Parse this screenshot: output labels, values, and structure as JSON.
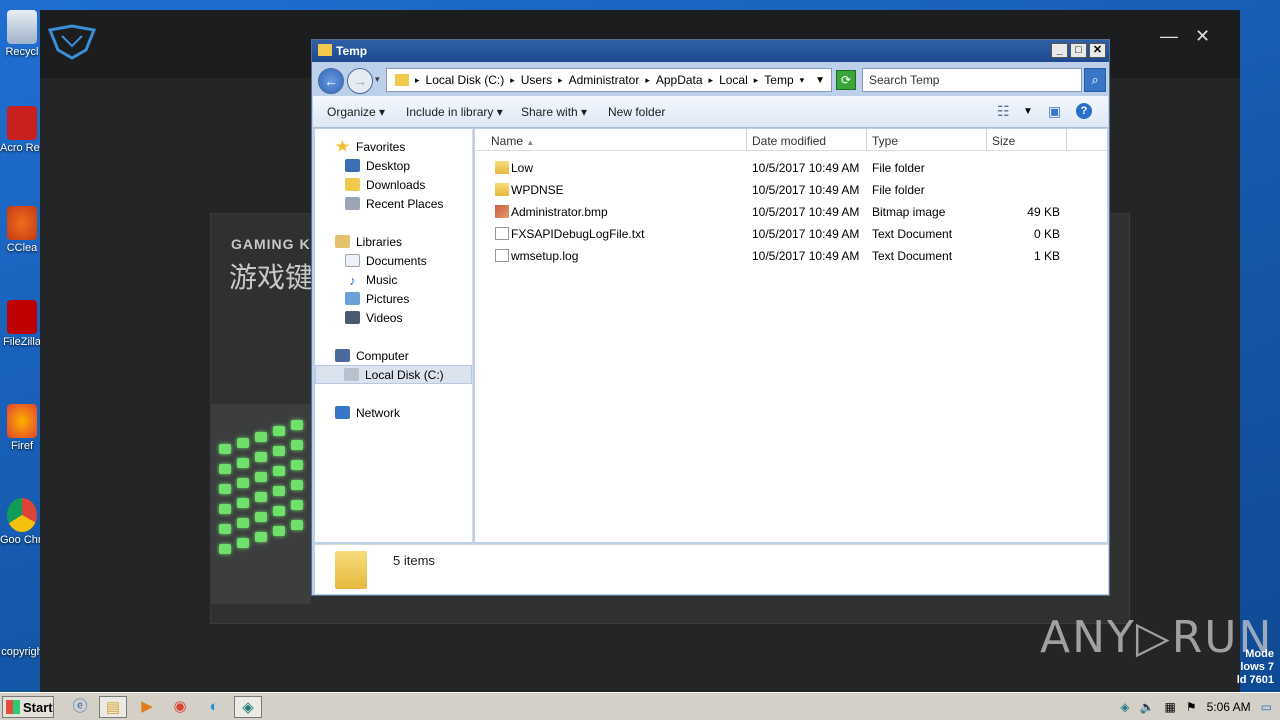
{
  "desktop": {
    "icons": [
      {
        "label": "Recycl"
      },
      {
        "label": "Acro Reade"
      },
      {
        "label": "CClea"
      },
      {
        "label": "FileZilla"
      },
      {
        "label": "Firef"
      },
      {
        "label": "Goo Chro"
      },
      {
        "label": "copyrigh"
      }
    ]
  },
  "background_app": {
    "heading": "GAMING K",
    "subheading": "游戏键",
    "minimize": "—",
    "close": "✕"
  },
  "watermark": {
    "text": "ANY▷RUN"
  },
  "mode_text": {
    "line1": "Mode",
    "line2": "lows 7",
    "line3": "ld 7601"
  },
  "explorer": {
    "title": "Temp",
    "controls": {
      "minimize": "_",
      "maximize": "□",
      "close": "✕"
    },
    "address": {
      "crumbs": [
        "Local Disk (C:)",
        "Users",
        "Administrator",
        "AppData",
        "Local",
        "Temp"
      ]
    },
    "search": {
      "placeholder": "Search Temp"
    },
    "toolbar": {
      "organize": "Organize",
      "include_in_library": "Include in library",
      "share_with": "Share with",
      "new_folder": "New folder"
    },
    "nav": {
      "favorites": "Favorites",
      "desktop": "Desktop",
      "downloads": "Downloads",
      "recent_places": "Recent Places",
      "libraries": "Libraries",
      "documents": "Documents",
      "music": "Music",
      "pictures": "Pictures",
      "videos": "Videos",
      "computer": "Computer",
      "local_disk": "Local Disk (C:)",
      "network": "Network"
    },
    "columns": {
      "name": "Name",
      "date_modified": "Date modified",
      "type": "Type",
      "size": "Size"
    },
    "files": [
      {
        "name": "Low",
        "date": "10/5/2017 10:49 AM",
        "type": "File folder",
        "size": "",
        "icon": "folder-icon"
      },
      {
        "name": "WPDNSE",
        "date": "10/5/2017 10:49 AM",
        "type": "File folder",
        "size": "",
        "icon": "folder-icon"
      },
      {
        "name": "Administrator.bmp",
        "date": "10/5/2017 10:49 AM",
        "type": "Bitmap image",
        "size": "49 KB",
        "icon": "bitmap-icon"
      },
      {
        "name": "FXSAPIDebugLogFile.txt",
        "date": "10/5/2017 10:49 AM",
        "type": "Text Document",
        "size": "0 KB",
        "icon": "text-file-icon"
      },
      {
        "name": "wmsetup.log",
        "date": "10/5/2017 10:49 AM",
        "type": "Text Document",
        "size": "1 KB",
        "icon": "text-file-icon"
      }
    ],
    "details": {
      "item_count": "5 items"
    }
  },
  "taskbar": {
    "start_label": "Start",
    "clock": "5:06 AM"
  }
}
